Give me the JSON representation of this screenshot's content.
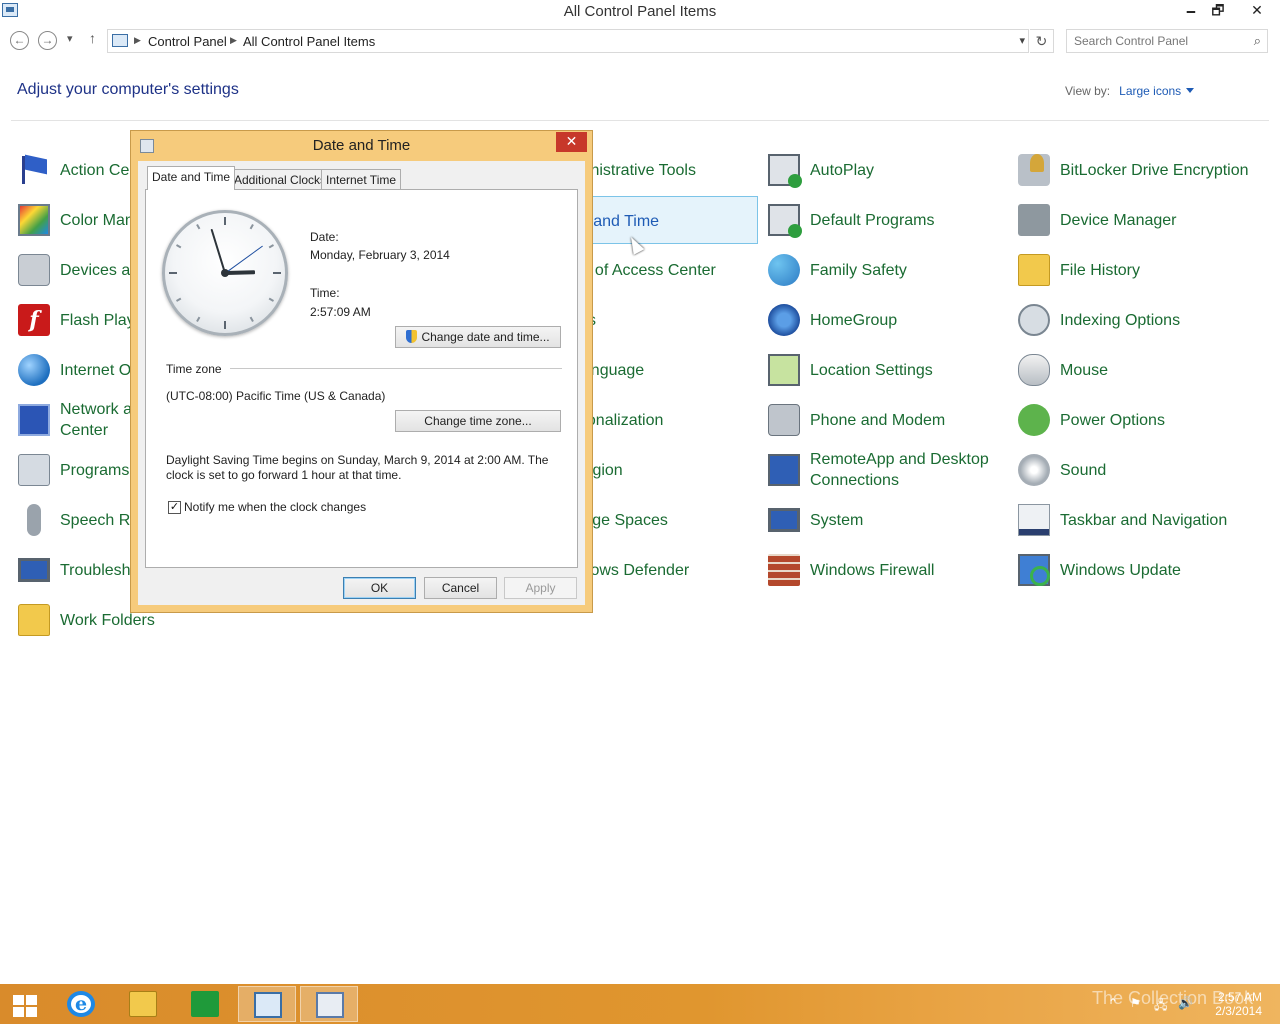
{
  "window": {
    "title": "All Control Panel Items",
    "controls": {
      "minimize": "🗕",
      "restore": "🗗",
      "close": "✕"
    }
  },
  "nav": {
    "back": "←",
    "forward": "→",
    "recent": "▾",
    "up": "↑",
    "breadcrumbs": [
      "Control Panel",
      "All Control Panel Items"
    ],
    "refresh": "↻",
    "search_placeholder": "Search Control Panel",
    "search_icon": "⌕"
  },
  "main": {
    "heading": "Adjust your computer's settings",
    "view_by_label": "View by:",
    "view_by_value": "Large icons"
  },
  "items": [
    {
      "label": "Action Center",
      "icon": "flag-icon"
    },
    {
      "label": "Color Management",
      "icon": "color-management-icon"
    },
    {
      "label": "Devices and Printers",
      "icon": "devices-icon"
    },
    {
      "label": "Flash Player",
      "icon": "flash-icon"
    },
    {
      "label": "Internet Options",
      "icon": "globe-icon"
    },
    {
      "label": "Network and Sharing Center",
      "icon": "network-icon"
    },
    {
      "label": "Programs and Features",
      "icon": "programs-icon"
    },
    {
      "label": "Speech Recognition",
      "icon": "microphone-icon"
    },
    {
      "label": "Troubleshooting",
      "icon": "troubleshoot-icon"
    },
    {
      "label": "Work Folders",
      "icon": "folder-icon"
    },
    {
      "label": "Administrative Tools",
      "icon": ""
    },
    {
      "label": "Date and Time",
      "icon": ""
    },
    {
      "label": "Ease of Access Center",
      "icon": ""
    },
    {
      "label": "Fonts",
      "icon": ""
    },
    {
      "label": "Language",
      "icon": ""
    },
    {
      "label": "Personalization",
      "icon": ""
    },
    {
      "label": "Region",
      "icon": ""
    },
    {
      "label": "Storage Spaces",
      "icon": ""
    },
    {
      "label": "Windows Defender",
      "icon": ""
    },
    {
      "label": "AutoPlay",
      "icon": "autoplay-icon"
    },
    {
      "label": "Default Programs",
      "icon": "default-programs-icon"
    },
    {
      "label": "Family Safety",
      "icon": "family-safety-icon"
    },
    {
      "label": "HomeGroup",
      "icon": "homegroup-icon"
    },
    {
      "label": "Location Settings",
      "icon": "location-icon"
    },
    {
      "label": "Phone and Modem",
      "icon": "phone-icon"
    },
    {
      "label": "RemoteApp and Desktop Connections",
      "icon": "remoteapp-icon"
    },
    {
      "label": "System",
      "icon": "system-icon"
    },
    {
      "label": "Windows Firewall",
      "icon": "firewall-icon"
    },
    {
      "label": "BitLocker Drive Encryption",
      "icon": "bitlocker-icon"
    },
    {
      "label": "Device Manager",
      "icon": "device-manager-icon"
    },
    {
      "label": "File History",
      "icon": "file-history-icon"
    },
    {
      "label": "Indexing Options",
      "icon": "indexing-icon"
    },
    {
      "label": "Mouse",
      "icon": "mouse-icon"
    },
    {
      "label": "Power Options",
      "icon": "power-icon"
    },
    {
      "label": "Sound",
      "icon": "sound-icon"
    },
    {
      "label": "Taskbar and Navigation",
      "icon": "taskbar-icon"
    },
    {
      "label": "Windows Update",
      "icon": "windows-update-icon"
    }
  ],
  "dialog": {
    "title": "Date and Time",
    "close": "✕",
    "tabs": [
      "Date and Time",
      "Additional Clocks",
      "Internet Time"
    ],
    "active_tab": "Date and Time",
    "date_label": "Date:",
    "date_value": "Monday, February 3, 2014",
    "time_label": "Time:",
    "time_value": "2:57:09 AM",
    "change_datetime_button": "Change date and time...",
    "timezone_heading": "Time zone",
    "timezone_value": "(UTC-08:00) Pacific Time (US & Canada)",
    "change_timezone_button": "Change time zone...",
    "dst_text": "Daylight Saving Time begins on Sunday, March 9, 2014 at 2:00 AM. The clock is set to go forward 1 hour at that time.",
    "notify_label": "Notify me when the clock changes",
    "notify_checked": true,
    "check_mark": "✓",
    "ok": "OK",
    "cancel": "Cancel",
    "apply": "Apply",
    "clock_time": {
      "hour": 2,
      "minute": 57,
      "second": 9
    }
  },
  "taskbar": {
    "tray_chevron": "⌃",
    "tray_icons": [
      "⚑",
      "🖧",
      "🔊"
    ],
    "clock_time": "2:57 AM",
    "clock_date": "2/3/2014",
    "watermark": "The Collection Book",
    "accent_color": "#e0962f"
  }
}
